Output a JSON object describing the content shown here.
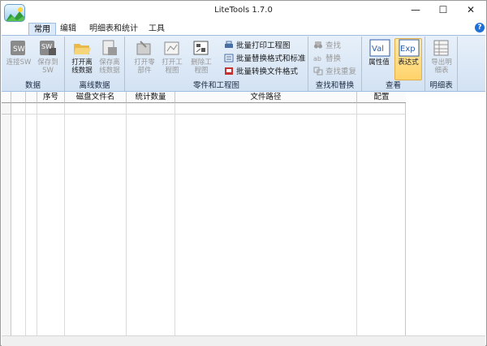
{
  "window": {
    "title": "LiteTools 1.7.0",
    "minimize": "—",
    "maximize": "☐",
    "close": "✕"
  },
  "tabs": [
    "常用",
    "编辑",
    "明细表和统计",
    "工具"
  ],
  "active_tab": "常用",
  "help": "?",
  "ribbon": {
    "groups": {
      "data": "数据",
      "offline": "离线数据",
      "parts": "零件和工程图",
      "find": "查找和替换",
      "view": "查看",
      "bom": "明细表"
    },
    "buttons": {
      "connect_sw": "连接SW",
      "save_to_sw": "保存到SW",
      "open_offline": "打开离线数据",
      "save_offline": "保存离线数据",
      "open_part": "打开零部件",
      "open_drawing": "打开工程图",
      "delete_drawing": "删除工程图",
      "batch_print": "批量打印工程图",
      "batch_replace": "批量替换格式和标准",
      "batch_convert": "批量转换文件格式",
      "find": "查找",
      "replace": "替换",
      "find_dup": "查找重复",
      "prop_value": "属性值",
      "expression": "表达式",
      "export_bom": "导出明细表",
      "val_icon": "Val",
      "exp_icon": "Exp"
    }
  },
  "table": {
    "headers": [
      "序号",
      "磁盘文件名",
      "统计数量",
      "文件路径",
      "配置"
    ]
  },
  "colors": {
    "accent": "#1e6fd6",
    "ribbon_bg": "#dbe8f6",
    "highlight": "#ffd36b"
  }
}
